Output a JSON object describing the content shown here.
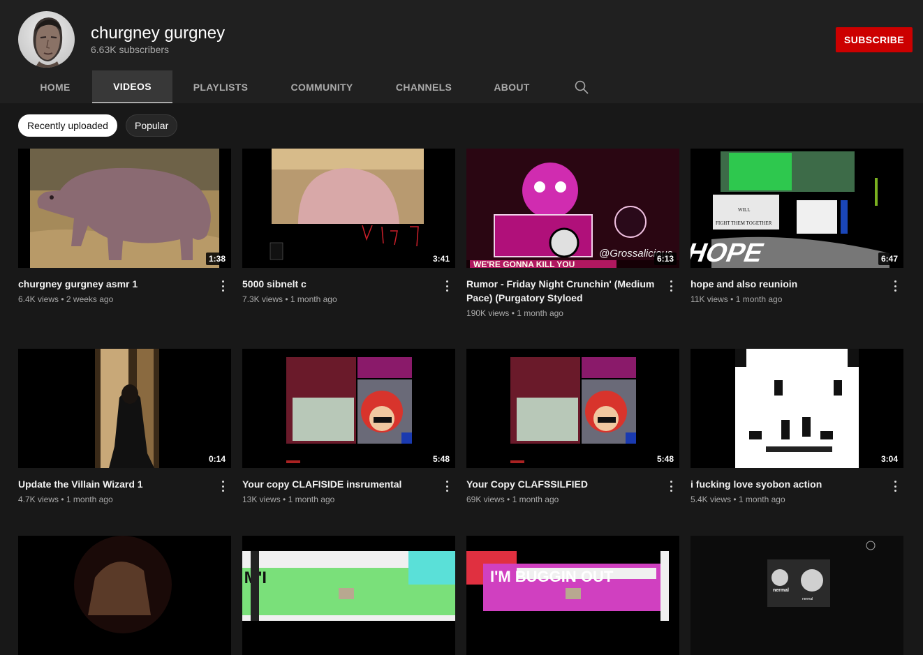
{
  "channel": {
    "name": "churgney gurgney",
    "subscribers": "6.63K subscribers",
    "subscribe_label": "SUBSCRIBE"
  },
  "tabs": [
    {
      "label": "HOME",
      "active": false
    },
    {
      "label": "VIDEOS",
      "active": true
    },
    {
      "label": "PLAYLISTS",
      "active": false
    },
    {
      "label": "COMMUNITY",
      "active": false
    },
    {
      "label": "CHANNELS",
      "active": false
    },
    {
      "label": "ABOUT",
      "active": false
    }
  ],
  "search_icon": "search-icon",
  "chips": [
    {
      "label": "Recently uploaded",
      "active": true
    },
    {
      "label": "Popular",
      "active": false
    }
  ],
  "videos": [
    {
      "title": "churgney gurgney asmr 1",
      "views": "6.4K views",
      "age": "2 weeks ago",
      "duration": "1:38"
    },
    {
      "title": "5000 sibnelt c",
      "views": "7.3K views",
      "age": "1 month ago",
      "duration": "3:41"
    },
    {
      "title": "Rumor - Friday Night Crunchin' (Medium Pace) (Purgatory Styloed",
      "views": "190K views",
      "age": "1 month ago",
      "duration": "6:13",
      "thumb_text": "WE'RE GONNA KILL YOU",
      "thumb_text2": "@Grossalicious"
    },
    {
      "title": "hope and also reunioin",
      "views": "11K views",
      "age": "1 month ago",
      "duration": "6:47",
      "thumb_text": "FIGHT THEM TOGETHER",
      "thumb_text2": "HOPE",
      "thumb_text3": "WILL"
    },
    {
      "title": "Update the Villain Wizard 1",
      "views": "4.7K views",
      "age": "1 month ago",
      "duration": "0:14"
    },
    {
      "title": "Your copy CLAFISIDE insrumental",
      "views": "13K views",
      "age": "1 month ago",
      "duration": "5:48"
    },
    {
      "title": "Your Copy CLAFSSILFIED",
      "views": "69K views",
      "age": "1 month ago",
      "duration": "5:48"
    },
    {
      "title": "i fucking love syobon action",
      "views": "5.4K views",
      "age": "1 month ago",
      "duration": "3:04"
    },
    {
      "title": "",
      "views": "",
      "age": "",
      "duration": ""
    },
    {
      "title": "",
      "views": "",
      "age": "",
      "duration": "",
      "thumb_text": "I'M BUGGIN OUT"
    },
    {
      "title": "",
      "views": "",
      "age": "",
      "duration": "",
      "thumb_text": "I'M BUGGIN OUT"
    },
    {
      "title": "",
      "views": "",
      "age": "",
      "duration": "",
      "thumb_text": "nermal",
      "thumb_text2": "nermal"
    }
  ]
}
